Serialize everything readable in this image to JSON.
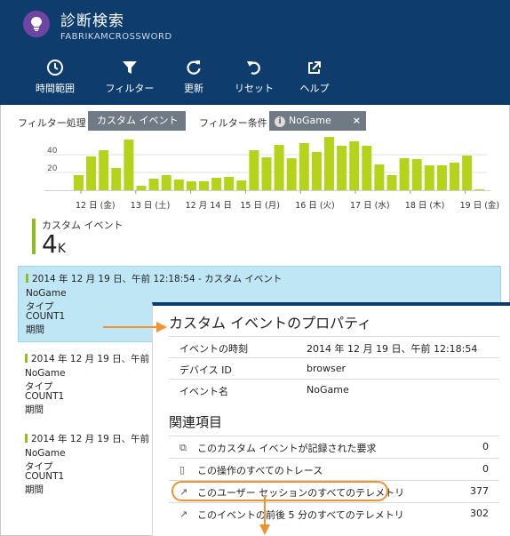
{
  "header": {
    "title": "診断検索",
    "subtitle": "FABRIKAMCROSSWORD",
    "toolbar": [
      {
        "icon": "clock-icon",
        "label": "時間範囲"
      },
      {
        "icon": "filter-icon",
        "label": "フィルター"
      },
      {
        "icon": "refresh-icon",
        "label": "更新"
      },
      {
        "icon": "reset-icon",
        "label": "リセット"
      },
      {
        "icon": "external-link-icon",
        "label": "ヘルプ"
      }
    ]
  },
  "filters": {
    "process_label": "フィルター処理",
    "process_value": "カスタム イベント",
    "condition_label": "フィルター条件",
    "condition_value": "NoGame",
    "remove_label": "×"
  },
  "chart_data": {
    "type": "bar",
    "y_ticks": [
      20,
      40
    ],
    "ylim": [
      0,
      60
    ],
    "x_tick_labels": [
      "12 日 (金)",
      "13 日 (土)",
      "12 月 14 日",
      "15 日 (月)",
      "16 日 (火)",
      "17 日 (水)",
      "18 日 (木)",
      "19 日 (金)"
    ],
    "values": [
      17,
      38,
      45,
      25,
      57,
      5,
      13,
      17,
      12,
      10,
      10,
      14,
      15,
      11,
      45,
      37,
      51,
      36,
      53,
      43,
      60,
      50,
      55,
      50,
      29,
      17,
      36,
      35,
      28,
      28,
      31,
      39,
      1
    ],
    "bar_color": "#b5d31a"
  },
  "summary": {
    "label": "カスタム イベント",
    "value": "4",
    "unit": "K",
    "accent": "#8fbc1e"
  },
  "events": [
    {
      "header": "2014 年 12 月 19 日、午前 12:18:54 - カスタム イベント",
      "lines": [
        "NoGame",
        "タイプ",
        "COUNT1",
        "期間"
      ],
      "selected": true
    },
    {
      "header": "2014 年 12 月 19 日、午前",
      "lines": [
        "NoGame",
        "タイプ",
        "COUNT1",
        "期間"
      ],
      "selected": false
    },
    {
      "header": "2014 年 12 月 19 日、午前",
      "lines": [
        "NoGame",
        "タイプ",
        "COUNT1",
        "期間"
      ],
      "selected": false
    }
  ],
  "properties": {
    "title": "カスタム イベントのプロパティ",
    "rows": [
      {
        "key": "イベントの時刻",
        "value": "2014 年 12 月 19 日、午前 12:18:54"
      },
      {
        "key": "デバイス ID",
        "value": "browser"
      },
      {
        "key": "イベント名",
        "value": "NoGame"
      }
    ]
  },
  "related": {
    "title": "関連項目",
    "rows": [
      {
        "icon": "copy-icon",
        "label": "このカスタム イベントが記録された要求",
        "count": "0"
      },
      {
        "icon": "document-icon",
        "label": "この操作のすべてのトレース",
        "count": "0"
      },
      {
        "icon": "arrow-diagonal-icon",
        "label": "このユーザー セッションのすべてのテレメトリ",
        "count": "377"
      },
      {
        "icon": "arrow-diagonal-icon",
        "label": "このイベントの前後 5 分のすべてのテレメトリ",
        "count": "302"
      }
    ]
  },
  "colors": {
    "header_bg": "#0e3d6d",
    "selection_bg": "#bfe6f5",
    "callout": "#f0922d"
  }
}
